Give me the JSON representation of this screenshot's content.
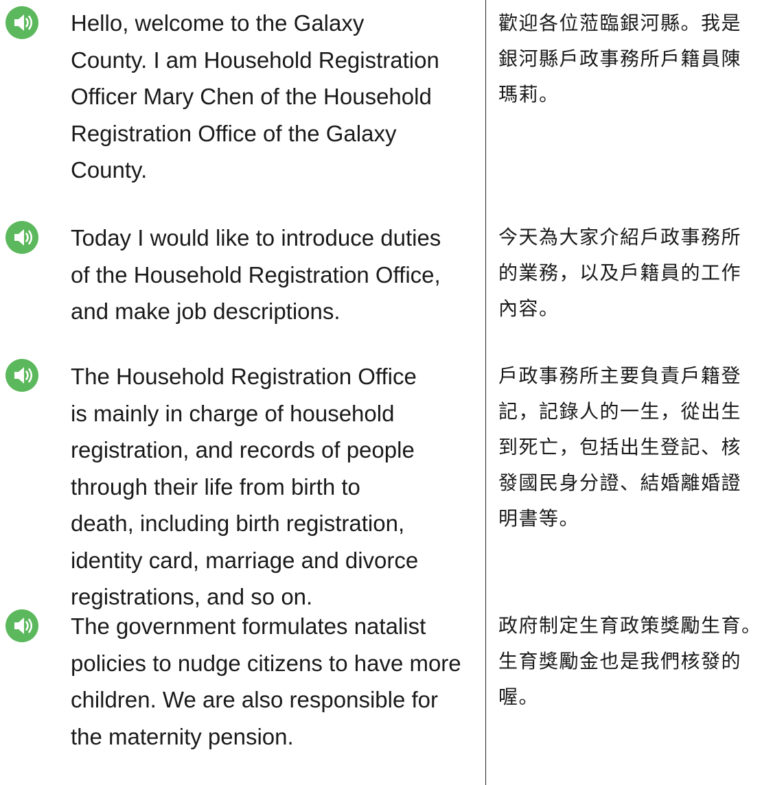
{
  "colors": {
    "speaker_icon_bg": "#5cb85c",
    "speaker_icon_fg": "#ffffff",
    "divider": "#222222",
    "text": "#1a1a1a"
  },
  "entries": [
    {
      "icon": "speaker-icon",
      "english": "Hello, welcome to the Galaxy\nCounty. I am Household Registration\nOfficer Mary Chen of the Household\nRegistration Office of the Galaxy\nCounty.",
      "chinese": "歡迎各位蒞臨銀河縣。我是\n銀河縣戶政事務所戶籍員陳\n瑪莉。"
    },
    {
      "icon": "speaker-icon",
      "english": "Today I would like to introduce duties\nof the Household Registration Office,\nand make job descriptions.",
      "chinese": "今天為大家介紹戶政事務所\n的業務，以及戶籍員的工作\n內容。"
    },
    {
      "icon": "speaker-icon",
      "english": "The Household Registration Office\nis mainly in charge of household\nregistration, and records of people\nthrough their life from birth to\ndeath, including birth registration,\nidentity card, marriage and divorce\nregistrations, and so on.",
      "chinese": "戶政事務所主要負責戶籍登\n記，記錄人的一生，從出生\n到死亡，包括出生登記、核\n發國民身分證、結婚離婚證\n明書等。"
    },
    {
      "icon": "speaker-icon",
      "english": "The government formulates natalist\npolicies to nudge citizens to have more\nchildren. We are also responsible for\nthe maternity pension.",
      "chinese": "政府制定生育政策獎勵生育。\n生育獎勵金也是我們核發的\n喔。"
    }
  ]
}
